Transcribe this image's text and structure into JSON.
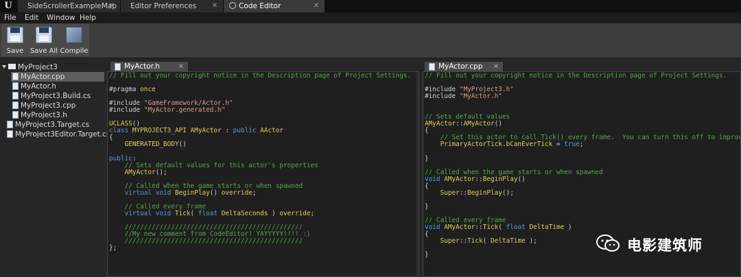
{
  "tabs": [
    {
      "label": "SideScrollerExampleMap",
      "active": false
    },
    {
      "label": "Editor Preferences",
      "active": false
    },
    {
      "label": "Code Editor",
      "active": true
    }
  ],
  "menu": [
    "File",
    "Edit",
    "Window",
    "Help"
  ],
  "toolbar": {
    "save": "Save",
    "save_all": "Save All",
    "compile": "Compile"
  },
  "tree": [
    {
      "label": "MyProject3",
      "type": "folder",
      "indent": 0
    },
    {
      "label": "MyActor.cpp",
      "type": "file",
      "indent": 1,
      "selected": true
    },
    {
      "label": "MyActor.h",
      "type": "file",
      "indent": 1
    },
    {
      "label": "MyProject3.Build.cs",
      "type": "file",
      "indent": 1
    },
    {
      "label": "MyProject3.cpp",
      "type": "file",
      "indent": 1
    },
    {
      "label": "MyProject3.h",
      "type": "file",
      "indent": 1
    },
    {
      "label": "MyProject3.Target.cs",
      "type": "file",
      "indent": 0
    },
    {
      "label": "MyProject3Editor.Target.cs",
      "type": "file",
      "indent": 0
    }
  ],
  "editors": [
    {
      "tab": "MyActor.h",
      "lines": [
        [
          [
            "// Fill out your copyright notice in the Description page of Project Settings.",
            "com"
          ]
        ],
        [],
        [
          [
            "#pragma ",
            "pp"
          ],
          [
            "once",
            "mac"
          ]
        ],
        [],
        [
          [
            "#include ",
            "pp"
          ],
          [
            "\"GameFramework/Actor.h\"",
            "str"
          ]
        ],
        [
          [
            "#include ",
            "pp"
          ],
          [
            "\"MyActor.generated.h\"",
            "str"
          ]
        ],
        [],
        [
          [
            "UCLASS",
            "mac"
          ],
          [
            "()",
            "pp"
          ]
        ],
        [
          [
            "class ",
            "kw"
          ],
          [
            "MYPROJECT3_API AMyActor",
            "mac"
          ],
          [
            " : ",
            "pp"
          ],
          [
            "public ",
            "kw"
          ],
          [
            "AActor",
            "mac"
          ]
        ],
        [
          [
            "{",
            "pp"
          ]
        ],
        [
          [
            "    ",
            "pp"
          ],
          [
            "GENERATED_BODY",
            "mac"
          ],
          [
            "()",
            "pp"
          ]
        ],
        [],
        [
          [
            "public",
            "kw"
          ],
          [
            ":",
            "pp"
          ]
        ],
        [
          [
            "    ",
            "pp"
          ],
          [
            "// Sets default values for this actor's properties",
            "com"
          ]
        ],
        [
          [
            "    ",
            "pp"
          ],
          [
            "AMyActor",
            "mac"
          ],
          [
            "();",
            "pp"
          ]
        ],
        [],
        [
          [
            "    ",
            "pp"
          ],
          [
            "// Called when the game starts or when spawned",
            "com"
          ]
        ],
        [
          [
            "    ",
            "pp"
          ],
          [
            "virtual void ",
            "kw"
          ],
          [
            "BeginPlay",
            "mac"
          ],
          [
            "() ",
            "pp"
          ],
          [
            "override",
            "mac"
          ],
          [
            ";",
            "pp"
          ]
        ],
        [],
        [
          [
            "    ",
            "pp"
          ],
          [
            "// Called every frame",
            "com"
          ]
        ],
        [
          [
            "    ",
            "pp"
          ],
          [
            "virtual void ",
            "kw"
          ],
          [
            "Tick",
            "mac"
          ],
          [
            "( ",
            "pp"
          ],
          [
            "float ",
            "kw"
          ],
          [
            "DeltaSeconds",
            "mac"
          ],
          [
            " ) ",
            "pp"
          ],
          [
            "override",
            "mac"
          ],
          [
            ";",
            "pp"
          ]
        ],
        [],
        [
          [
            "    ",
            "pp"
          ],
          [
            "//////////////////////////////////////////////",
            "com"
          ]
        ],
        [
          [
            "    ",
            "pp"
          ],
          [
            "//My new comment from CodeEditor! YAYYYYY!!!! :)",
            "com"
          ]
        ],
        [
          [
            "    ",
            "pp"
          ],
          [
            "//////////////////////////////////////////////",
            "com"
          ]
        ],
        [
          [
            "};",
            "pp"
          ]
        ]
      ]
    },
    {
      "tab": "MyActor.cpp",
      "lines": [
        [
          [
            "// Fill out your copyright notice in the Description page of Project Settings.",
            "com"
          ]
        ],
        [],
        [
          [
            "#include ",
            "pp"
          ],
          [
            "\"MyProject3.h\"",
            "str"
          ]
        ],
        [
          [
            "#include ",
            "pp"
          ],
          [
            "\"MyActor.h\"",
            "str"
          ]
        ],
        [],
        [],
        [
          [
            "// Sets default values",
            "com"
          ]
        ],
        [
          [
            "AMyActor",
            "mac"
          ],
          [
            "::",
            "pp"
          ],
          [
            "AMyActor",
            "mac"
          ],
          [
            "()",
            "pp"
          ]
        ],
        [
          [
            "{",
            "pp"
          ]
        ],
        [
          [
            "    ",
            "pp"
          ],
          [
            "// Set this actor to call Tick() every frame.  You can turn this off to improve p",
            "com"
          ]
        ],
        [
          [
            "    ",
            "pp"
          ],
          [
            "PrimaryActorTick",
            "mac"
          ],
          [
            ".",
            "pp"
          ],
          [
            "bCanEverTick",
            "mac"
          ],
          [
            " = ",
            "pp"
          ],
          [
            "true",
            "kw"
          ],
          [
            ";",
            "pp"
          ]
        ],
        [],
        [
          [
            "}",
            "pp"
          ]
        ],
        [],
        [
          [
            "// Called when the game starts or when spawned",
            "com"
          ]
        ],
        [
          [
            "void ",
            "kw"
          ],
          [
            "AMyActor",
            "mac"
          ],
          [
            "::",
            "pp"
          ],
          [
            "BeginPlay",
            "mac"
          ],
          [
            "()",
            "pp"
          ]
        ],
        [
          [
            "{",
            "pp"
          ]
        ],
        [
          [
            "    ",
            "pp"
          ],
          [
            "Super",
            "mac"
          ],
          [
            "::",
            "pp"
          ],
          [
            "BeginPlay",
            "mac"
          ],
          [
            "();",
            "pp"
          ]
        ],
        [],
        [
          [
            "}",
            "pp"
          ]
        ],
        [],
        [
          [
            "// Called every frame",
            "com"
          ]
        ],
        [
          [
            "void ",
            "kw"
          ],
          [
            "AMyActor",
            "mac"
          ],
          [
            "::",
            "pp"
          ],
          [
            "Tick",
            "mac"
          ],
          [
            "( ",
            "pp"
          ],
          [
            "float ",
            "kw"
          ],
          [
            "DeltaTime",
            "mac"
          ],
          [
            " )",
            "pp"
          ]
        ],
        [
          [
            "{",
            "pp"
          ]
        ],
        [
          [
            "    ",
            "pp"
          ],
          [
            "Super",
            "mac"
          ],
          [
            "::",
            "pp"
          ],
          [
            "Tick",
            "mac"
          ],
          [
            "( ",
            "pp"
          ],
          [
            "DeltaTime",
            "mac"
          ],
          [
            " );",
            "pp"
          ]
        ],
        [],
        [
          [
            "}",
            "pp"
          ]
        ]
      ]
    }
  ],
  "watermark": {
    "text": "电影建筑师"
  }
}
